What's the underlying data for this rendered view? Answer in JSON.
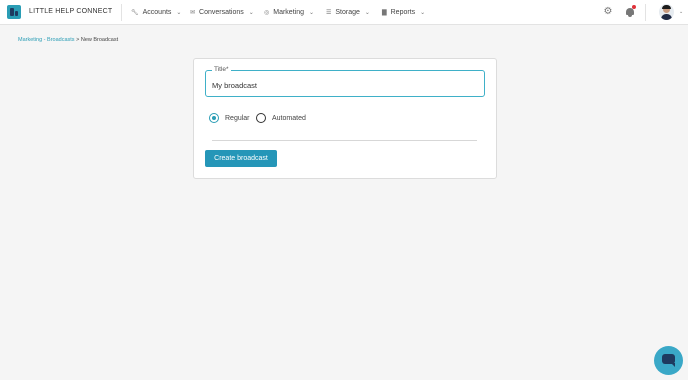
{
  "header": {
    "brand": "LITTLE HELP CONNECT",
    "nav": [
      {
        "label": "Accounts",
        "icon": "wrench-icon"
      },
      {
        "label": "Conversations",
        "icon": "chat-bubbles-icon"
      },
      {
        "label": "Marketing",
        "icon": "broadcast-icon"
      },
      {
        "label": "Storage",
        "icon": "list-icon"
      },
      {
        "label": "Reports",
        "icon": "bar-chart-icon"
      }
    ],
    "notification_dot_color": "#e0323a"
  },
  "breadcrumb": {
    "parent": "Marketing - Broadcasts",
    "separator": ">",
    "current": "New Broadcast"
  },
  "form": {
    "title_label": "Title",
    "required_mark": "*",
    "title_value": "My broadcast",
    "radio_options": [
      {
        "label": "Regular",
        "checked": true
      },
      {
        "label": "Automated",
        "checked": false
      }
    ],
    "submit_label": "Create broadcast"
  },
  "colors": {
    "accent": "#2a9db5",
    "button": "#2596b8",
    "brand_dark": "#1e3a5f"
  }
}
